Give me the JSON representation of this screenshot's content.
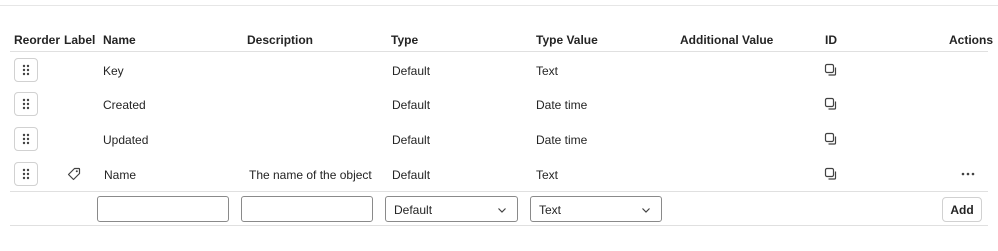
{
  "table": {
    "headers": {
      "reorder": "Reorder",
      "label": "Label",
      "name": "Name",
      "description": "Description",
      "type": "Type",
      "type_value": "Type Value",
      "additional_value": "Additional Value",
      "id": "ID",
      "actions": "Actions"
    },
    "rows": [
      {
        "name": "Key",
        "description": "",
        "type": "Default",
        "type_value": "Text"
      },
      {
        "name": "Created",
        "description": "",
        "type": "Default",
        "type_value": "Date time"
      },
      {
        "name": "Updated",
        "description": "",
        "type": "Default",
        "type_value": "Date time"
      },
      {
        "name": "Name",
        "description": "The name of the object",
        "type": "Default",
        "type_value": "Text"
      }
    ]
  },
  "new_row": {
    "name_value": "",
    "description_value": "",
    "type_selected": "Default",
    "type_value_selected": "Text",
    "add_label": "Add"
  },
  "icons": {
    "drag": "drag-handle-icon",
    "label": "tag-icon",
    "copy": "copy-icon",
    "more": "more-horizontal-icon"
  }
}
